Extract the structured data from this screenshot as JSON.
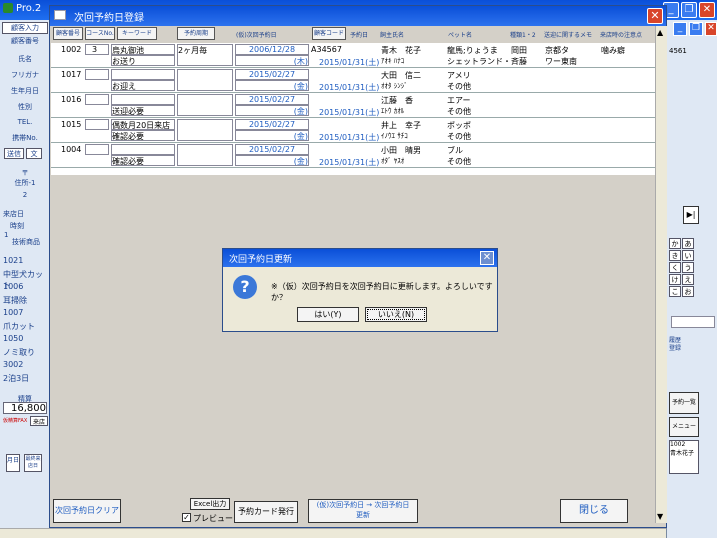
{
  "outer": {
    "title": "Pro.2"
  },
  "main": {
    "title": "次回予約日登録"
  },
  "headers": {
    "btn_customer_no": "顧客番号",
    "btn_course_no": "コースNo.",
    "btn_keyword": "キーワード",
    "btn_cycle": "予約周期",
    "col_provisional": "(仮)次回予約日",
    "btn_customer_code": "顧客コード",
    "col_reserve": "予約日",
    "col_owner": "飼主氏名",
    "col_pet": "ペット名",
    "col_breed": "種類1・2",
    "col_memo": "送迎に関するメモ",
    "col_notes": "来店時の注意点"
  },
  "rows": [
    {
      "no": "1002",
      "course": "3",
      "keyword": "烏丸御池",
      "keyword2": "お送り",
      "cycle": "2ヶ月毎",
      "prov_date": "2006/12/28",
      "prov_dow": "(木)",
      "code": "A34567",
      "reserve": "2015/01/31(土)",
      "owner": "青木　花子",
      "owner_kana": "ｱｵｷ ﾊﾅｺ",
      "pet": "龍馬;りょうま",
      "pet2": "シェットランド・シ",
      "breed": "岡田",
      "breed2": "斉藤",
      "memo": "京都タ",
      "memo2": "ワー東南",
      "notes": "噛み癖"
    },
    {
      "no": "1017",
      "course": "",
      "keyword": "",
      "keyword2": "お迎え",
      "cycle": "",
      "prov_date": "2015/02/27",
      "prov_dow": "(金)",
      "code": "",
      "reserve": "2015/01/31(土)",
      "owner": "大田　信二",
      "owner_kana": "ｵｵﾀ ｼﾝｼﾞ",
      "pet": "アメリ",
      "pet2": "その他",
      "breed": "",
      "breed2": "",
      "memo": "",
      "memo2": "",
      "notes": ""
    },
    {
      "no": "1016",
      "course": "",
      "keyword": "",
      "keyword2": "送迎必要",
      "cycle": "",
      "prov_date": "2015/02/27",
      "prov_dow": "(金)",
      "code": "",
      "reserve": "2015/01/31(土)",
      "owner": "江藤　香",
      "owner_kana": "ｴﾄｳ ｶｵﾙ",
      "pet": "エアー",
      "pet2": "その他",
      "breed": "",
      "breed2": "",
      "memo": "",
      "memo2": "",
      "notes": ""
    },
    {
      "no": "1015",
      "course": "",
      "keyword": "偶数月20日来店",
      "keyword2": "確認必要",
      "cycle": "",
      "prov_date": "2015/02/27",
      "prov_dow": "(金)",
      "code": "",
      "reserve": "2015/01/31(土)",
      "owner": "井上　幸子",
      "owner_kana": "ｲﾉｳｴ ｻﾁｺ",
      "pet": "ポッポ",
      "pet2": "その他",
      "breed": "",
      "breed2": "",
      "memo": "",
      "memo2": "",
      "notes": ""
    },
    {
      "no": "1004",
      "course": "",
      "keyword": "",
      "keyword2": "確認必要",
      "cycle": "",
      "prov_date": "2015/02/27",
      "prov_dow": "(金)",
      "code": "",
      "reserve": "2015/01/31(土)",
      "owner": "小田　晴男",
      "owner_kana": "ｵﾀﾞ ﾔｽｵ",
      "pet": "ブル",
      "pet2": "その他",
      "breed": "",
      "breed2": "",
      "memo": "",
      "memo2": "",
      "notes": ""
    }
  ],
  "footer": {
    "clear_button": "次回予約日クリア",
    "excel_button": "Excel出力",
    "preview_label": "プレビュー",
    "card_button": "予約カード発行",
    "update_button_line1": "(仮)次回予約日 → 次回予約日",
    "update_button_line2": "更新",
    "close_button": "閉じる"
  },
  "dialog": {
    "title": "次回予約日更新",
    "message": "※（仮）次回予約日を次回予約日に更新します。よろしいですか？",
    "yes": "はい(Y)",
    "no": "いいえ(N)"
  },
  "left": {
    "items": [
      "顧客入力",
      "顧客番号",
      "氏名",
      "フリガナ",
      "生年月日",
      "性別",
      "TEL.",
      "携帯No.",
      "送信",
      "文",
      "〒",
      "住所-1",
      "2",
      "来店日",
      "時刻",
      "1",
      "技術商品",
      "1021",
      "中型犬カット",
      "1006",
      "耳掃除",
      "1007",
      "爪カット",
      "1050",
      "ノミ取り",
      "3002",
      "2泊3日",
      "精算",
      "16,800",
      "仮精算FAX",
      "来店",
      "月日",
      "最終来店日"
    ]
  },
  "right": {
    "kana": [
      "か",
      "あ",
      "き",
      "い",
      "く",
      "う",
      "け",
      "え",
      "こ",
      "お"
    ],
    "items": [
      "予約一覧",
      "メニュー",
      "1002",
      "青木花子",
      "履歴",
      "登録",
      "予約一覧",
      "4561"
    ]
  }
}
